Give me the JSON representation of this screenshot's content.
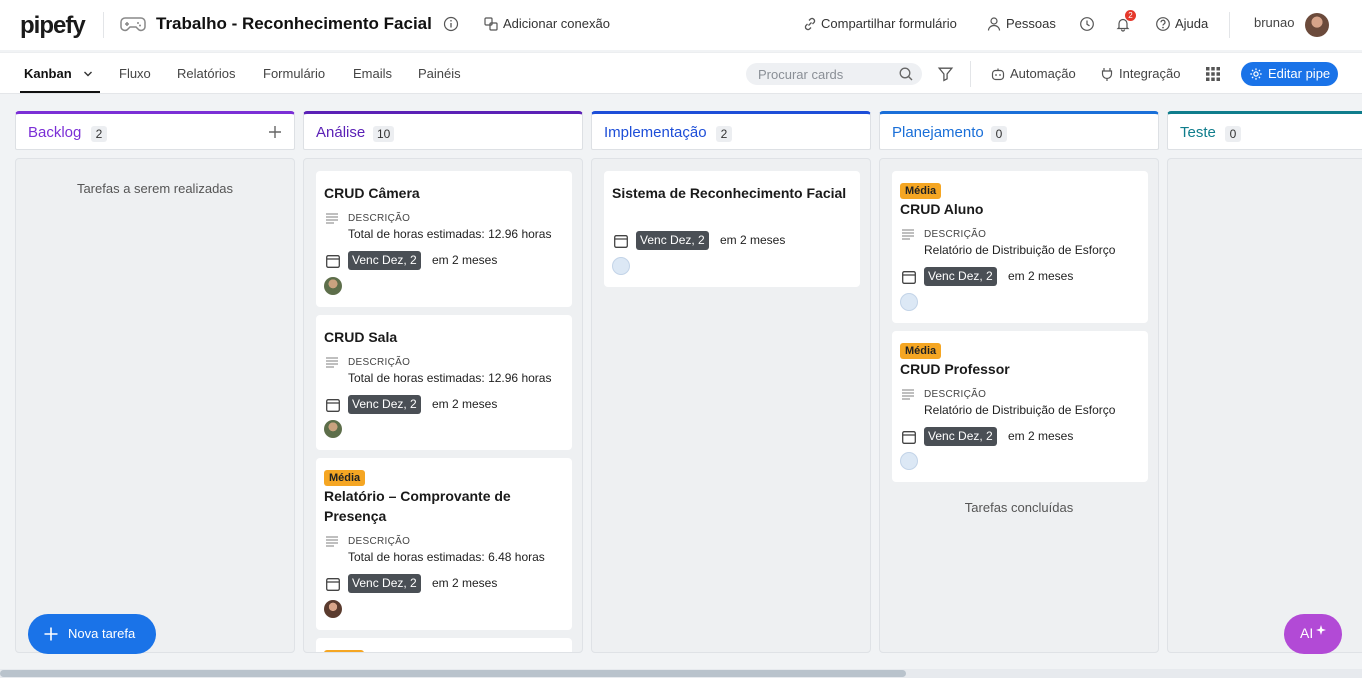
{
  "app": {
    "logo": "pipefy",
    "pipe_title": "Trabalho - Reconhecimento Facial",
    "add_connection": "Adicionar conexão",
    "share_form": "Compartilhar formulário",
    "people": "Pessoas",
    "help": "Ajuda",
    "notifications_count": "2",
    "username": "brunao"
  },
  "nav": {
    "tabs": [
      {
        "label": "Kanban"
      },
      {
        "label": "Fluxo"
      },
      {
        "label": "Relatórios"
      },
      {
        "label": "Formulário"
      },
      {
        "label": "Emails"
      },
      {
        "label": "Painéis"
      }
    ],
    "search_placeholder": "Procurar cards",
    "automation": "Automação",
    "integration": "Integração",
    "edit_pipe": "Editar pipe"
  },
  "phases": [
    {
      "name": "Backlog",
      "count": "2",
      "color": "#7b2fd6",
      "empty_text": "Tarefas a serem realizadas"
    },
    {
      "name": "Análise",
      "count": "10",
      "color": "#5b21b6"
    },
    {
      "name": "Implementação",
      "count": "2",
      "color": "#1d4ed8"
    },
    {
      "name": "Planejamento",
      "count": "0",
      "color": "#1a6fd8",
      "footer_text": "Tarefas concluídas"
    },
    {
      "name": "Teste",
      "count": "0",
      "color": "#0f7d8c"
    }
  ],
  "cards": {
    "analise": [
      {
        "title": "CRUD Câmera",
        "desc_label": "DESCRIÇÃO",
        "desc": "Total de horas estimadas: 12.96 horas",
        "due": "Venc Dez, 2",
        "relative": "em 2 meses"
      },
      {
        "title": "CRUD Sala",
        "desc_label": "DESCRIÇÃO",
        "desc": "Total de horas estimadas: 12.96 horas",
        "due": "Venc Dez, 2",
        "relative": "em 2 meses"
      },
      {
        "badge": "Média",
        "title": "Relatório – Comprovante de Presença",
        "desc_label": "DESCRIÇÃO",
        "desc": "Total de horas estimadas: 6.48 horas",
        "due": "Venc Dez, 2",
        "relative": "em 2 meses"
      }
    ],
    "implementacao": [
      {
        "title": "Sistema de Reconhecimento Facial",
        "due": "Venc Dez, 2",
        "relative": "em 2 meses"
      }
    ],
    "planejamento": [
      {
        "badge": "Média",
        "title": "CRUD Aluno",
        "desc_label": "DESCRIÇÃO",
        "desc": "Relatório de Distribuição de Esforço",
        "due": "Venc Dez, 2",
        "relative": "em 2 meses"
      },
      {
        "badge": "Média",
        "title": "CRUD Professor",
        "desc_label": "DESCRIÇÃO",
        "desc": "Relatório de Distribuição de Esforço",
        "due": "Venc Dez, 2",
        "relative": "em 2 meses"
      }
    ]
  },
  "actions": {
    "new_task": "Nova tarefa",
    "ai": "AI"
  },
  "colors": {
    "primary": "#1a73e8",
    "ai": "#b24ad6",
    "badge_media": "#f5a623"
  }
}
